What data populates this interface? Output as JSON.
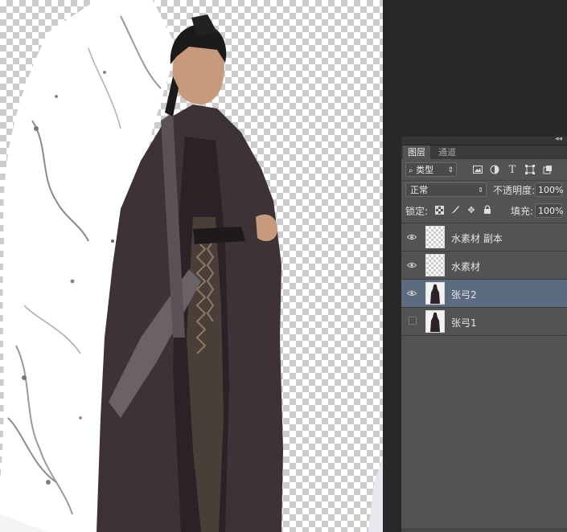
{
  "panel": {
    "tabs": [
      {
        "label": "图层"
      },
      {
        "label": "通道"
      }
    ],
    "collapse_label": "◂◂",
    "filter": {
      "label": "类型",
      "icon": "search-icon"
    },
    "filter_icons": [
      "image-filter-icon",
      "adjustment-filter-icon",
      "type-filter-icon",
      "shape-filter-icon",
      "smart-object-filter-icon"
    ],
    "blend_mode": "正常",
    "opacity_label": "不透明度:",
    "opacity_value": "100%",
    "lock_label": "锁定:",
    "lock_icons": [
      "lock-transparent-icon",
      "lock-image-icon",
      "lock-position-icon",
      "lock-all-icon"
    ],
    "fill_label": "填充:",
    "fill_value": "100%",
    "layers": [
      {
        "name": "水素材 副本",
        "visible": true,
        "selected": false,
        "thumb": "transparent"
      },
      {
        "name": "水素材",
        "visible": true,
        "selected": false,
        "thumb": "transparent"
      },
      {
        "name": "张弓2",
        "visible": true,
        "selected": true,
        "thumb": "person"
      },
      {
        "name": "张弓1",
        "visible": false,
        "selected": false,
        "thumb": "person"
      }
    ]
  },
  "colors": {
    "panel_bg": "#535353",
    "selected_layer": "#5d6b80",
    "app_bg": "#282828",
    "robe": "#3d3236"
  }
}
